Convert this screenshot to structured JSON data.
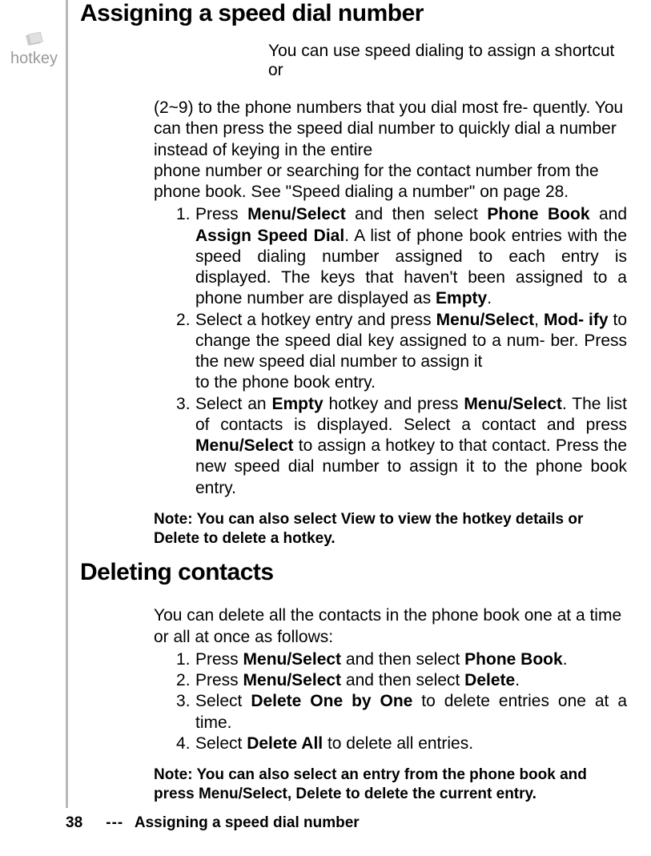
{
  "margin": {
    "label": "hotkey"
  },
  "section1": {
    "heading": "Assigning a speed dial number",
    "intro": "You can use speed dialing to assign a shortcut or",
    "para1": "(2~9) to the phone numbers that you dial most fre- quently. You can then press the speed dial number to quickly dial a number instead of keying in the entire",
    "para2": "phone number or searching for the contact number from the phone book. See \"Speed dialing a number\" on page 28.",
    "step1": {
      "t1": "Press ",
      "b1": "Menu/Select",
      "t2": " and then select ",
      "b2": "Phone Book",
      "t3": " and ",
      "b3": "Assign Speed Dial",
      "t4": ". A list of phone book entries with the speed dialing number assigned to each entry is displayed. The keys that haven't been assigned to a phone number are displayed as ",
      "b4": "Empty",
      "t5": "."
    },
    "step2": {
      "t1": "Select a hotkey entry and press ",
      "b1": "Menu/Select",
      "t2": ", ",
      "b2": "Mod- ify",
      "t3": " to change the speed dial key assigned to a num- ber. Press the new speed dial number to assign it",
      "line2": "to the phone book entry."
    },
    "step3": {
      "t1": "Select an ",
      "b1": "Empty",
      "t2": " hotkey and press ",
      "b2": "Menu/Select",
      "t3": ". The list of contacts is displayed. Select a contact and press ",
      "b3": "Menu/Select",
      "t4": " to assign a hotkey to that contact. Press the new speed dial number to assign it to the phone book entry."
    },
    "note": "Note: You can also select View to view the hotkey details or Delete to delete a hotkey."
  },
  "section2": {
    "heading": "Deleting contacts",
    "para": "You can delete all the contacts in the phone book one at a time or all at once as follows:",
    "s1": {
      "t1": "Press ",
      "b1": "Menu/Select",
      "t2": " and then select ",
      "b2": "Phone Book",
      "t3": "."
    },
    "s2": {
      "t1": "Press ",
      "b1": "Menu/Select",
      "t2": " and then select ",
      "b2": "Delete",
      "t3": "."
    },
    "s3": {
      "t1": "Select ",
      "b1": "Delete One by One",
      "t2": " to delete entries one at a time."
    },
    "s4": {
      "t1": "Select ",
      "b1": "Delete All",
      "t2": " to delete all entries."
    },
    "note": "Note: You can also select an entry from the phone book and press Menu/Select, Delete to delete the current entry."
  },
  "footer": {
    "page": "38",
    "sep": "---",
    "title": "Assigning a speed dial number"
  }
}
